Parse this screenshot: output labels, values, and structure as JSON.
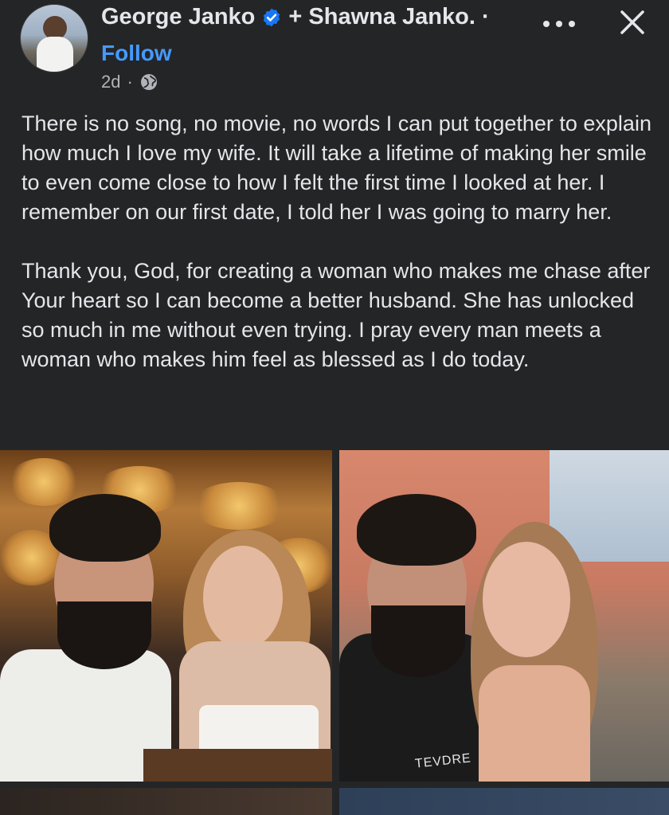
{
  "post": {
    "author": "George Janko",
    "coauthor": "+ Shawna Janko. ·",
    "follow_label": "Follow",
    "time": "2d",
    "meta_separator": "·",
    "paragraphs": [
      "There is no song, no movie, no words I can put together to explain how much I love my wife. It will take a lifetime of making her smile to even come close to how I felt the first time I looked at her. I remember on our first date, I told her I was going to marry her.",
      "Thank you, God, for creating a woman who makes me chase after Your heart so I can become a better husband. She has unlocked so much in me without even trying. I pray every man meets a woman who makes him feel as blessed as I do today."
    ],
    "photo_right_shirt_text": "TEVDRE"
  },
  "icons": {
    "verified": "verified-badge-icon",
    "audience": "globe-icon",
    "more": "more-options-icon",
    "close": "close-icon"
  },
  "colors": {
    "background": "#242526",
    "text": "#e4e6eb",
    "link": "#4599ff",
    "muted": "#b0b3b8",
    "verified": "#1877f2"
  }
}
